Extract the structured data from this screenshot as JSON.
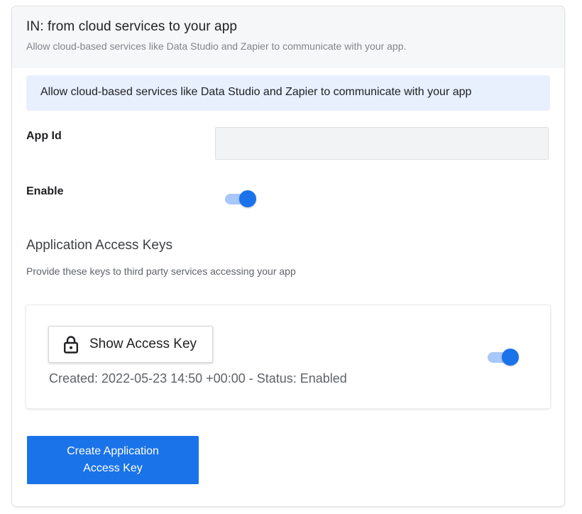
{
  "header": {
    "title": "IN: from cloud services to your app",
    "subtitle": "Allow cloud-based services like Data Studio and Zapier to communicate with your app."
  },
  "info_banner": {
    "text": "Allow cloud-based services like Data Studio and Zapier to communicate with your app"
  },
  "form": {
    "app_id_label": "App Id",
    "app_id_value": "",
    "enable_label": "Enable",
    "enable_on": true
  },
  "access_keys": {
    "title": "Application Access Keys",
    "subtitle": "Provide these keys to third party services accessing your app",
    "keys": [
      {
        "show_label": "Show Access Key",
        "created_text": "Created: 2022-05-23 14:50 +00:00 - Status: Enabled",
        "enabled": true
      }
    ],
    "create_button_label": "Create Application Access Key"
  },
  "colors": {
    "accent": "#1a73e8",
    "toggle_track": "#a8c7fa",
    "banner_bg": "#e8f0fe",
    "header_bg": "#f6f7f8"
  },
  "icons": {
    "lock": "lock-icon"
  }
}
